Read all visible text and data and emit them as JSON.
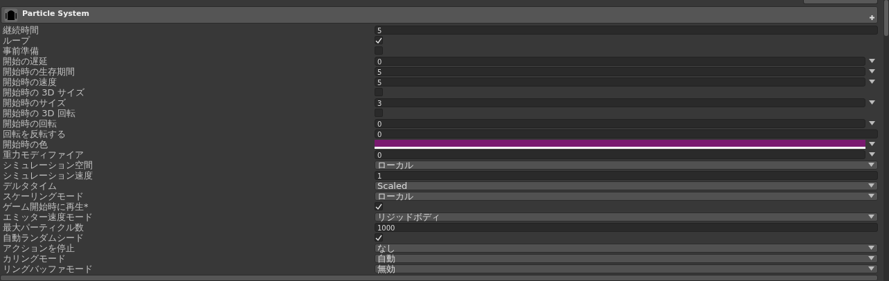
{
  "component": {
    "title": "Particle System"
  },
  "properties": [
    {
      "label": "継続時間",
      "kind": "number",
      "value": "5"
    },
    {
      "label": "ループ",
      "kind": "checkbox",
      "checked": true
    },
    {
      "label": "事前準備",
      "kind": "checkbox",
      "checked": false
    },
    {
      "label": "開始の遅延",
      "kind": "curve",
      "value": "0"
    },
    {
      "label": "開始時の生存期間",
      "kind": "curve",
      "value": "5"
    },
    {
      "label": "開始時の速度",
      "kind": "curve",
      "value": "5"
    },
    {
      "label": "開始時の 3D サイズ",
      "kind": "checkbox",
      "checked": false
    },
    {
      "label": "開始時のサイズ",
      "kind": "curve",
      "value": "3"
    },
    {
      "label": "開始時の 3D 回転",
      "kind": "checkbox",
      "checked": false
    },
    {
      "label": "開始時の回転",
      "kind": "curve",
      "value": "0"
    },
    {
      "label": "回転を反転する",
      "kind": "number",
      "value": "0"
    },
    {
      "label": "開始時の色",
      "kind": "color",
      "color": "#7a1a70"
    },
    {
      "label": "重力モディファイア",
      "kind": "curve",
      "value": "0"
    },
    {
      "label": "シミュレーション空間",
      "kind": "dropdown",
      "value": "ローカル"
    },
    {
      "label": "シミュレーション速度",
      "kind": "number",
      "value": "1"
    },
    {
      "label": "デルタタイム",
      "kind": "dropdown",
      "value": "Scaled"
    },
    {
      "label": "スケーリングモード",
      "kind": "dropdown",
      "value": "ローカル"
    },
    {
      "label": "ゲーム開始時に再生*",
      "kind": "checkbox",
      "checked": true
    },
    {
      "label": "エミッター速度モード",
      "kind": "dropdown",
      "value": "リジッドボディ"
    },
    {
      "label": "最大パーティクル数",
      "kind": "number",
      "value": "1000"
    },
    {
      "label": "自動ランダムシード",
      "kind": "checkbox",
      "checked": true
    },
    {
      "label": "アクションを停止",
      "kind": "dropdown",
      "value": "なし"
    },
    {
      "label": "カリングモード",
      "kind": "dropdown",
      "value": "自動"
    },
    {
      "label": "リングバッファモード",
      "kind": "dropdown",
      "value": "無効"
    }
  ]
}
